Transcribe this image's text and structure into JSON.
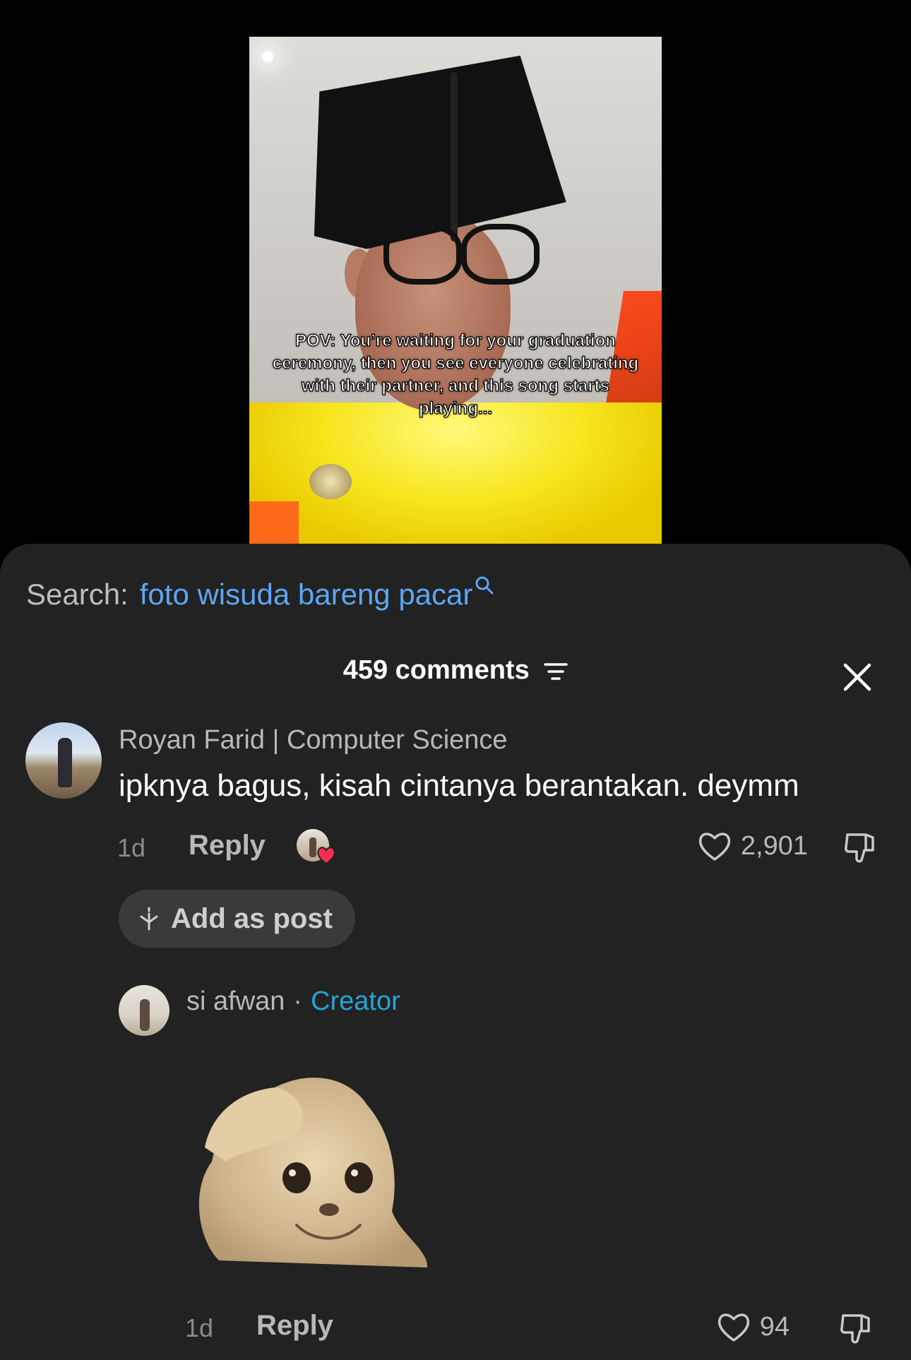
{
  "video": {
    "caption": "POV: You’re waiting for your graduation ceremony, then you see everyone celebrating with their partner, and this song starts playing..."
  },
  "search": {
    "label": "Search:",
    "query": "foto wisuda bareng pacar"
  },
  "comments_header": {
    "count_label": "459 comments"
  },
  "comments": [
    {
      "username": "Royan Farid | Computer Science",
      "text": "ipknya bagus, kisah cintanya berantakan. deymm",
      "time": "1d",
      "reply_label": "Reply",
      "likes": "2,901",
      "add_post_label": "Add as post"
    },
    {
      "username": "si afwan",
      "separator": "·",
      "badge": "Creator",
      "sticker": "cat-salute-sticker",
      "time": "1d",
      "reply_label": "Reply",
      "likes": "94"
    }
  ],
  "icons": {
    "search": "search-icon",
    "filter": "filter-icon",
    "close": "close-icon",
    "heart": "heart-icon",
    "dislike": "dislike-icon",
    "sparkle": "sparkle-icon"
  },
  "colors": {
    "sheet_bg": "#222222",
    "link_blue": "#5ba7f2",
    "creator_blue": "#26a4d6",
    "like_heart_red": "#fe2c55"
  }
}
